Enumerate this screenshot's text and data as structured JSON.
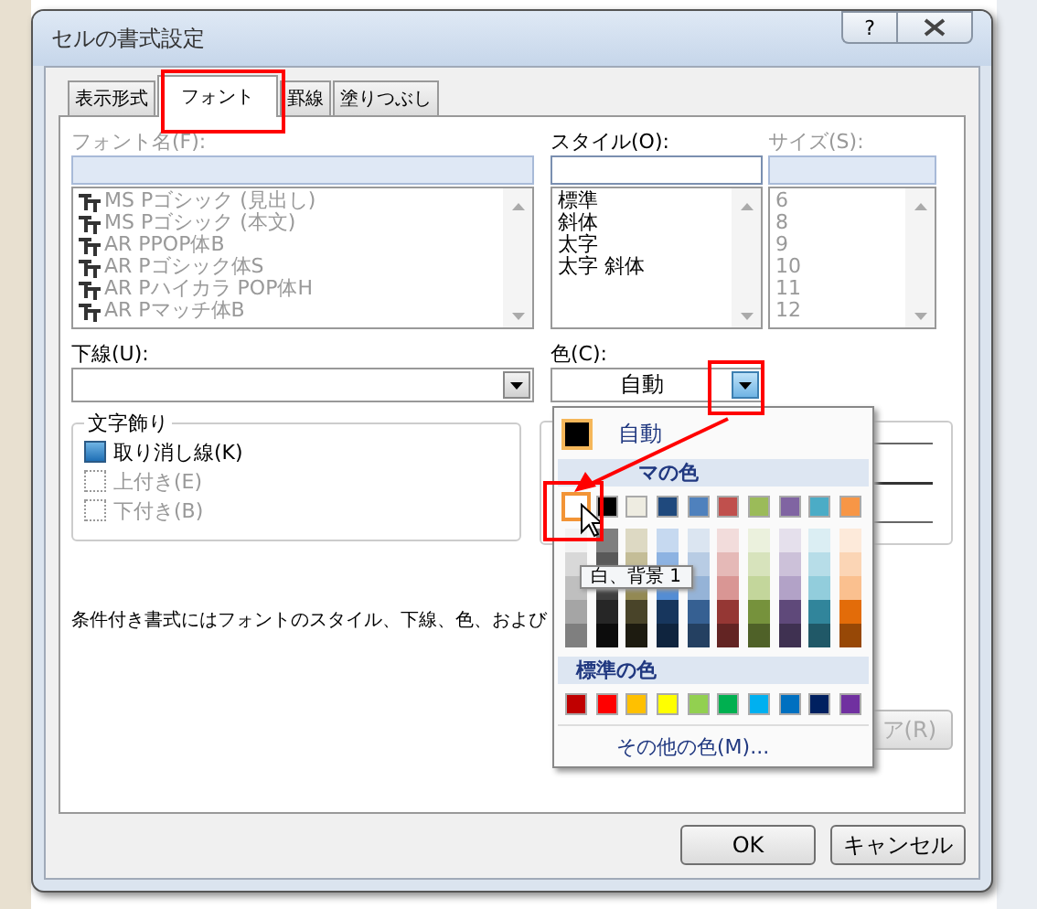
{
  "window": {
    "title": "セルの書式設定",
    "help_button": "?"
  },
  "tabs": [
    {
      "label": "表示形式",
      "selected": false
    },
    {
      "label": "フォント",
      "selected": true
    },
    {
      "label": "罫線",
      "selected": false
    },
    {
      "label": "塗りつぶし",
      "selected": false
    }
  ],
  "font_name": {
    "label": "フォント名(F):",
    "disabled": true,
    "items": [
      "MS Pゴシック (見出し)",
      "MS Pゴシック (本文)",
      "AR PPOP体B",
      "AR Pゴシック体S",
      "AR Pハイカラ POP体H",
      "AR Pマッチ体B"
    ]
  },
  "style": {
    "label": "スタイル(O):",
    "disabled": false,
    "items": [
      "標準",
      "斜体",
      "太字",
      "太字 斜体"
    ]
  },
  "size": {
    "label": "サイズ(S):",
    "disabled": true,
    "items": [
      "6",
      "8",
      "9",
      "10",
      "11",
      "12"
    ]
  },
  "underline": {
    "label": "下線(U):"
  },
  "color": {
    "label": "色(C):",
    "value": "自動",
    "open": true
  },
  "effects": {
    "title": "文字飾り",
    "items": [
      {
        "label": "取り消し線(K)",
        "checked": true,
        "disabled": false
      },
      {
        "label": "上付き(E)",
        "checked": false,
        "disabled": true
      },
      {
        "label": "下付き(B)",
        "checked": false,
        "disabled": true
      }
    ]
  },
  "note": "条件付き書式にはフォントのスタイル、下線、色、および",
  "clear_button": "ア(R)",
  "color_picker": {
    "automatic": {
      "label": "自動",
      "color": "#000000"
    },
    "theme_heading": "マの色",
    "theme_top": [
      {
        "color": "#ffffff",
        "selected": true
      },
      {
        "color": "#000000",
        "selected": false
      },
      {
        "color": "#eeece1",
        "selected": false
      },
      {
        "color": "#1f497d",
        "selected": false
      },
      {
        "color": "#4f81bd",
        "selected": false
      },
      {
        "color": "#c0504d",
        "selected": false
      },
      {
        "color": "#9bbb59",
        "selected": false
      },
      {
        "color": "#8064a2",
        "selected": false
      },
      {
        "color": "#4bacc6",
        "selected": false
      },
      {
        "color": "#f79646",
        "selected": false
      }
    ],
    "theme_shades": [
      {
        "swatches": [
          {
            "color": "#f2f2f2"
          },
          {
            "color": "#d8d8d8"
          },
          {
            "color": "#bfbfbf"
          },
          {
            "color": "#a5a5a5"
          },
          {
            "color": "#7f7f7f"
          }
        ]
      },
      {
        "swatches": [
          {
            "color": "#7f7f7f"
          },
          {
            "color": "#595959"
          },
          {
            "color": "#3f3f3f"
          },
          {
            "color": "#262626"
          },
          {
            "color": "#0c0c0c"
          }
        ]
      },
      {
        "swatches": [
          {
            "color": "#ddd9c3"
          },
          {
            "color": "#c4bd97"
          },
          {
            "color": "#938953"
          },
          {
            "color": "#494429"
          },
          {
            "color": "#1d1b10"
          }
        ]
      },
      {
        "swatches": [
          {
            "color": "#c6d9f0"
          },
          {
            "color": "#8db3e2"
          },
          {
            "color": "#548dd4"
          },
          {
            "color": "#17365d"
          },
          {
            "color": "#0f243e"
          }
        ]
      },
      {
        "swatches": [
          {
            "color": "#dbe5f1"
          },
          {
            "color": "#b8cce4"
          },
          {
            "color": "#95b3d7"
          },
          {
            "color": "#366092"
          },
          {
            "color": "#244061"
          }
        ]
      },
      {
        "swatches": [
          {
            "color": "#f2dcdb"
          },
          {
            "color": "#e5b9b7"
          },
          {
            "color": "#d99694"
          },
          {
            "color": "#953734"
          },
          {
            "color": "#632423"
          }
        ]
      },
      {
        "swatches": [
          {
            "color": "#ebf1dd"
          },
          {
            "color": "#d7e3bc"
          },
          {
            "color": "#c3d69b"
          },
          {
            "color": "#76923c"
          },
          {
            "color": "#4f6128"
          }
        ]
      },
      {
        "swatches": [
          {
            "color": "#e5e0ec"
          },
          {
            "color": "#ccc1d9"
          },
          {
            "color": "#b2a2c7"
          },
          {
            "color": "#5f497a"
          },
          {
            "color": "#3f3151"
          }
        ]
      },
      {
        "swatches": [
          {
            "color": "#dbeef3"
          },
          {
            "color": "#b7dde8"
          },
          {
            "color": "#92cddc"
          },
          {
            "color": "#31859b"
          },
          {
            "color": "#205867"
          }
        ]
      },
      {
        "swatches": [
          {
            "color": "#fdeada"
          },
          {
            "color": "#fbd5b5"
          },
          {
            "color": "#fac08f"
          },
          {
            "color": "#e36c09"
          },
          {
            "color": "#974806"
          }
        ]
      }
    ],
    "standard_heading": "標準の色",
    "standard": [
      {
        "color": "#c00000"
      },
      {
        "color": "#ff0000"
      },
      {
        "color": "#ffc000"
      },
      {
        "color": "#ffff00"
      },
      {
        "color": "#92d050"
      },
      {
        "color": "#00b050"
      },
      {
        "color": "#00b0f0"
      },
      {
        "color": "#0070c0"
      },
      {
        "color": "#002060"
      },
      {
        "color": "#7030a0"
      }
    ],
    "more_colors": "その他の色(M)...",
    "tooltip": "白、背景 1"
  },
  "buttons": [
    "OK",
    "キャンセル"
  ]
}
